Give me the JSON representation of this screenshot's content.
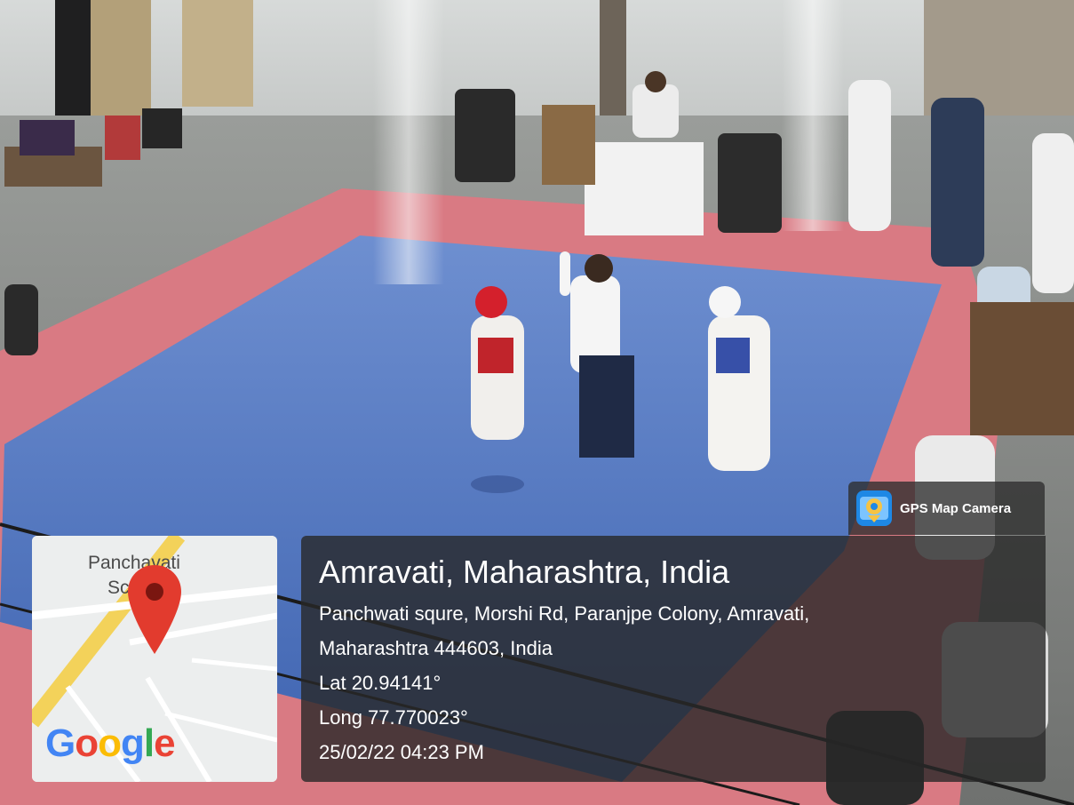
{
  "badge": {
    "label": "GPS Map Camera",
    "icon": "gps-map-camera-app-icon"
  },
  "map": {
    "place_name_line1": "Panchavati",
    "place_name_line2": "Sc",
    "logo_text": "Google",
    "marker_icon": "location-pin-icon",
    "colors": {
      "pin": "#e23b2e",
      "road": "#ffffff",
      "major_road": "#f3d25a"
    }
  },
  "location": {
    "title": "Amravati, Maharashtra, India",
    "address_line1": "Panchwati squre, Morshi Rd, Paranjpe Colony, Amravati,",
    "address_line2": "Maharashtra 444603, India",
    "latitude": "Lat 20.94141°",
    "longitude": "Long 77.770023°",
    "timestamp": "25/02/22 04:23 PM"
  }
}
